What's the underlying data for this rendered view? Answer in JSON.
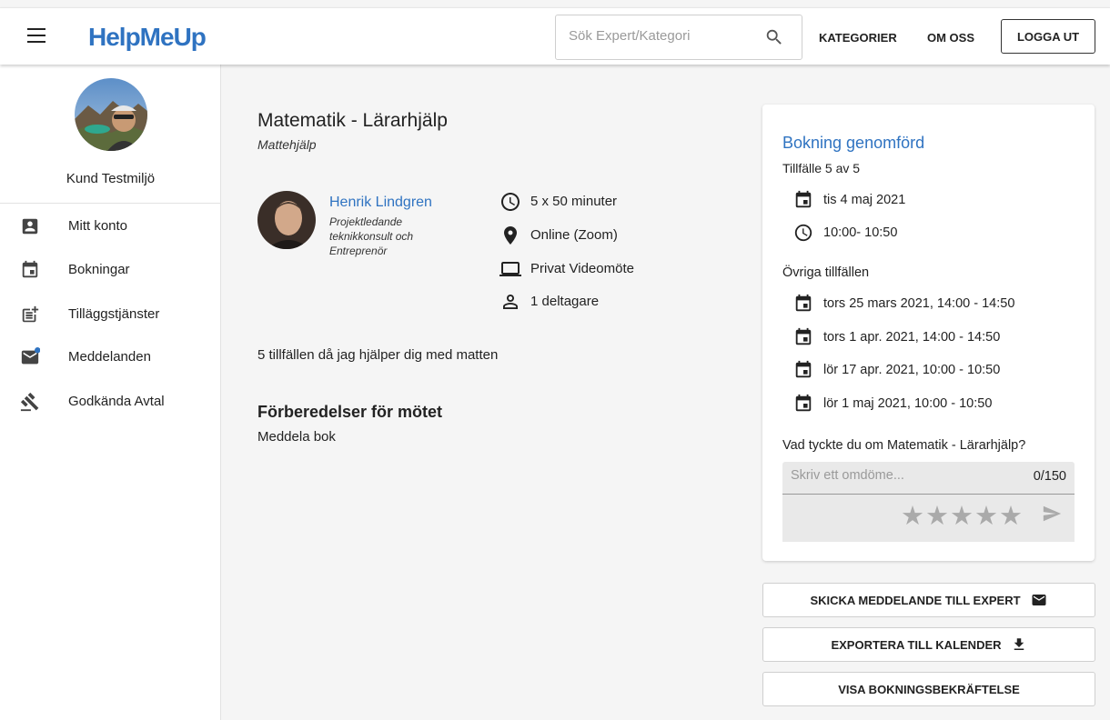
{
  "header": {
    "logo": "HelpMeUp",
    "search_placeholder": "Sök Expert/Kategori",
    "nav": {
      "categories": "KATEGORIER",
      "about": "OM OSS",
      "logout": "LOGGA UT"
    }
  },
  "sidebar": {
    "username": "Kund Testmiljö",
    "items": [
      {
        "label": "Mitt konto",
        "icon": "account-box-icon"
      },
      {
        "label": "Bokningar",
        "icon": "calendar-icon"
      },
      {
        "label": "Tilläggstjänster",
        "icon": "post-add-icon"
      },
      {
        "label": "Meddelanden",
        "icon": "mail-icon",
        "badge": true
      },
      {
        "label": "Godkända Avtal",
        "icon": "gavel-icon"
      }
    ]
  },
  "booking": {
    "title": "Matematik - Lärarhjälp",
    "subtitle": "Mattehjälp",
    "expert": {
      "name": "Henrik Lindgren",
      "role": "Projektledande teknikkonsult och Entreprenör"
    },
    "details": {
      "duration": "5 x 50 minuter",
      "location": "Online (Zoom)",
      "meeting_type": "Privat Videomöte",
      "participants": "1 deltagare"
    },
    "description": "5 tillfällen då jag hjälper dig med matten",
    "prep_title": "Förberedelser för mötet",
    "prep_text": "Meddela bok"
  },
  "status_card": {
    "title": "Bokning genomförd",
    "session": "Tillfälle 5 av 5",
    "date": "tis 4 maj 2021",
    "time": "10:00- 10:50",
    "other_label": "Övriga tillfällen",
    "other_sessions": [
      "tors 25 mars 2021, 14:00 - 14:50",
      "tors 1 apr. 2021, 14:00 - 14:50",
      "lör 17 apr. 2021, 10:00 - 10:50",
      "lör 1 maj 2021, 10:00 - 10:50"
    ],
    "review_question": "Vad tyckte du om Matematik - Lärarhjälp?",
    "review_placeholder": "Skriv ett omdöme...",
    "review_count": "0/150",
    "rating": 0,
    "rating_max": 5
  },
  "actions": {
    "message_expert": "SKICKA MEDDELANDE TILL EXPERT",
    "export_calendar": "EXPORTERA TILL KALENDER",
    "show_confirmation": "VISA BOKNINGSBEKRÄFTELSE"
  },
  "colors": {
    "accent": "#2f73c1",
    "badge": "#2f73c1"
  }
}
